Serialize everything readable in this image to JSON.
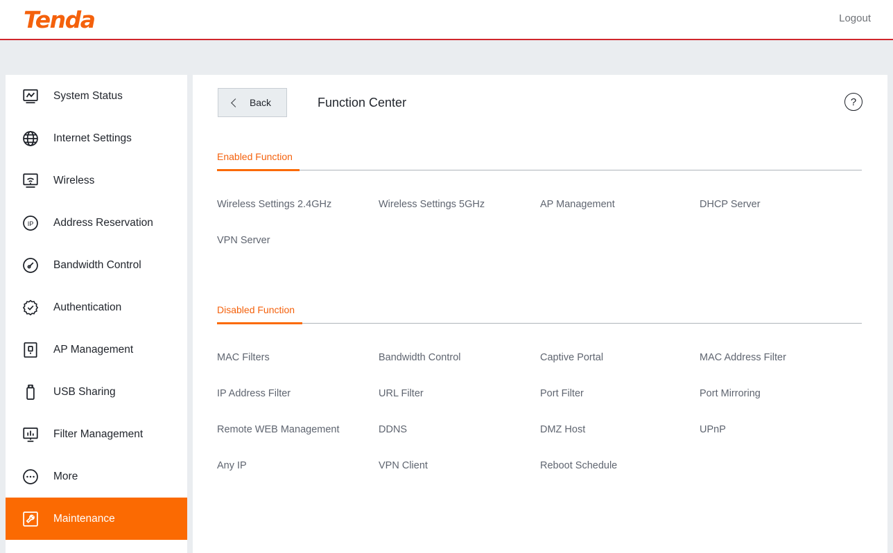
{
  "brand": {
    "logo_text": "Tenda",
    "logo_color": "#f4610c",
    "accent_color": "#fb6a02",
    "header_rule_color": "#d0262c"
  },
  "header": {
    "logout_label": "Logout"
  },
  "sidebar": {
    "items": [
      {
        "label": "System Status",
        "icon": "monitor-chart-icon",
        "active": false
      },
      {
        "label": "Internet Settings",
        "icon": "globe-icon",
        "active": false
      },
      {
        "label": "Wireless",
        "icon": "wifi-screen-icon",
        "active": false
      },
      {
        "label": "Address Reservation",
        "icon": "ip-circle-icon",
        "active": false
      },
      {
        "label": "Bandwidth Control",
        "icon": "gauge-icon",
        "active": false
      },
      {
        "label": "Authentication",
        "icon": "badge-check-icon",
        "active": false
      },
      {
        "label": "AP Management",
        "icon": "access-point-icon",
        "active": false
      },
      {
        "label": "USB Sharing",
        "icon": "usb-drive-icon",
        "active": false
      },
      {
        "label": "Filter Management",
        "icon": "bar-chart-icon",
        "active": false
      },
      {
        "label": "More",
        "icon": "ellipsis-circle-icon",
        "active": false
      },
      {
        "label": "Maintenance",
        "icon": "wrench-box-icon",
        "active": true
      }
    ]
  },
  "main": {
    "back_label": "Back",
    "title": "Function Center",
    "help_glyph": "?",
    "sections": [
      {
        "title": "Enabled Function",
        "items": [
          "Wireless Settings 2.4GHz",
          "Wireless Settings 5GHz",
          "AP Management",
          "DHCP Server",
          "VPN Server"
        ]
      },
      {
        "title": "Disabled Function",
        "items": [
          "MAC Filters",
          "Bandwidth Control",
          "Captive Portal",
          "MAC Address Filter",
          "IP Address Filter",
          "URL Filter",
          "Port Filter",
          "Port Mirroring",
          "Remote WEB Management",
          "DDNS",
          "DMZ Host",
          "UPnP",
          "Any IP",
          "VPN Client",
          "Reboot Schedule"
        ]
      }
    ]
  }
}
